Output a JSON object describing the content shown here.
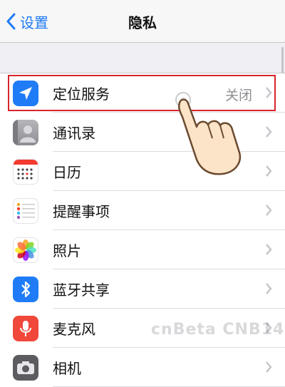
{
  "navbar": {
    "back_label": "设置",
    "title": "隐私"
  },
  "rows": [
    {
      "label": "定位服务",
      "value": "关闭",
      "icon": "location-arrow-icon",
      "color": "#1f7cf6"
    },
    {
      "label": "通讯录",
      "icon": "contacts-icon",
      "color": "#9a9aa0"
    },
    {
      "label": "日历",
      "icon": "calendar-icon",
      "color": "#ffffff"
    },
    {
      "label": "提醒事项",
      "icon": "reminders-icon",
      "color": "#ffffff"
    },
    {
      "label": "照片",
      "icon": "photos-icon",
      "color": "#ffffff"
    },
    {
      "label": "蓝牙共享",
      "icon": "bluetooth-icon",
      "color": "#1f7cf6"
    },
    {
      "label": "麦克风",
      "icon": "microphone-icon",
      "color": "#f0483a"
    },
    {
      "label": "相机",
      "icon": "camera-icon",
      "color": "#5c5c60"
    }
  ],
  "watermark": "cnBeta CNB14"
}
